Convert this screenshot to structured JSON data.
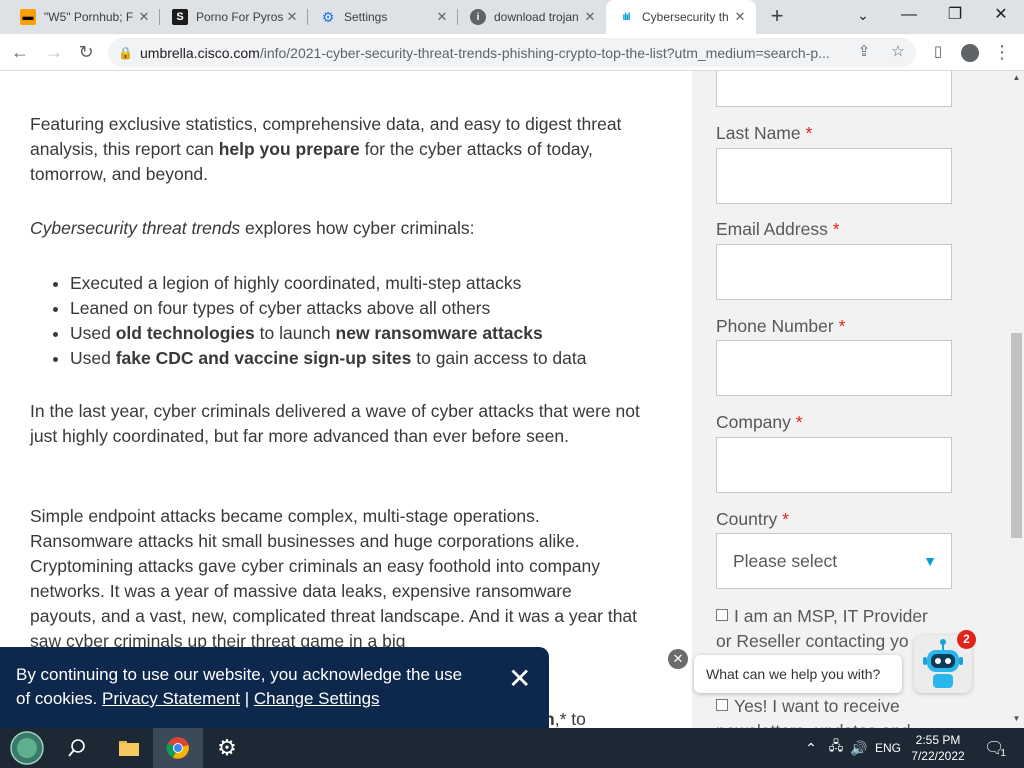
{
  "browser": {
    "tabs": [
      {
        "title": "\"W5\" Pornhub; F",
        "icon": "pornhub-favicon-icon",
        "active": false
      },
      {
        "title": "Porno For Pyros",
        "icon": "s-favicon-icon",
        "active": false
      },
      {
        "title": "Settings",
        "icon": "gear-icon",
        "active": false
      },
      {
        "title": "download trojan",
        "icon": "info-icon",
        "active": false
      },
      {
        "title": "Cybersecurity th",
        "icon": "cisco-icon",
        "active": true
      }
    ],
    "new_tab": "+",
    "window_controls": {
      "minimize": "—",
      "restore": "❐",
      "close": "✕",
      "tab_search": "⌄"
    },
    "url_domain": "umbrella.cisco.com",
    "url_path": "/info/2021-cyber-security-threat-trends-phishing-crypto-top-the-list?utm_medium=search-p..."
  },
  "article": {
    "intro_part1": "Featuring exclusive statistics, comprehensive data, and easy to digest threat analysis, this report can ",
    "intro_bold": "help you prepare",
    "intro_part2": " for the cyber attacks of today, tomorrow, and beyond.",
    "explores_italic": "Cybersecurity threat trends",
    "explores_rest": " explores how cyber criminals:",
    "bullets": {
      "b1": "Executed a legion of highly coordinated, multi-step attacks",
      "b2": "Leaned on four types of cyber attacks above all others",
      "b3_a": "Used ",
      "b3_b": "old technologies",
      "b3_c": " to launch ",
      "b3_d": "new ransomware attacks",
      "b4_a": "Used ",
      "b4_b": "fake CDC and vaccine sign-up sites",
      "b4_c": " to gain access to data"
    },
    "para_last_year": "In the last year, cyber criminals delivered a wave of cyber attacks that were not just highly coordinated, but far more advanced than ever before seen.",
    "para_endpoint": "Simple endpoint attacks became complex, multi-stage operations. Ransomware attacks hit small businesses and huge corporations alike. Cryptomining attacks gave cyber criminals an easy foothold into company networks. It was a year of massive data leaks, expensive ransomware payouts, and a vast, new, complicated threat landscape. And it was a year that saw cyber criminals up their threat game in a big",
    "partial_bold": "n",
    "partial_tail": ",* to"
  },
  "form": {
    "last_name_label": "Last Name",
    "email_label": "Email Address",
    "phone_label": "Phone Number",
    "company_label": "Company",
    "country_label": "Country",
    "required_mark": "*",
    "country_placeholder": "Please select",
    "msp_check": "I am an MSP, IT Provider or Reseller contacting yo",
    "newsletter_check": "Yes! I want to receive newsletters, updates and"
  },
  "cookie_banner": {
    "text": "By continuing to use our website, you acknowledge the use of cookies.",
    "privacy_link": "Privacy Statement",
    "separator": "|",
    "settings_link": "Change Settings",
    "close": "✕"
  },
  "chat": {
    "prompt": "What can we help you with?",
    "badge": "2",
    "close": "✕"
  },
  "taskbar": {
    "lang": "ENG",
    "time": "2:55 PM",
    "date": "7/22/2022",
    "notif_count": "1"
  },
  "colors": {
    "cookie_bg": "#0d274d",
    "required": "#e2231a",
    "cisco_blue": "#049fd9",
    "sidebar_bg": "#f2f2f2"
  }
}
